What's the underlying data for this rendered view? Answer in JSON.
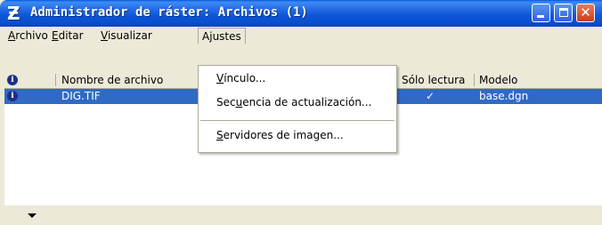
{
  "window": {
    "title": "Administrador de ráster: Archivos (1)",
    "icon": "microstation-app-icon",
    "controls": {
      "minimize": "minimize-icon",
      "maximize": "maximize-icon",
      "close": "close-icon"
    }
  },
  "menubar": {
    "items": [
      {
        "pre": "",
        "key": "A",
        "post": "rchivo"
      },
      {
        "pre": "",
        "key": "E",
        "post": "ditar"
      },
      {
        "pre": "",
        "key": "V",
        "post": "isualizar"
      },
      {
        "pre": "A",
        "key": "j",
        "post": "ustes"
      }
    ]
  },
  "dropdown": {
    "items": [
      {
        "pre": "",
        "key": "V",
        "post": "ínculo..."
      },
      {
        "pre": "Sec",
        "key": "u",
        "post": "encia de actualización..."
      },
      {
        "pre": "",
        "key": "S",
        "post": "ervidores de imagen..."
      }
    ]
  },
  "table": {
    "columns": [
      "Nombre de archivo",
      "Sólo lectura",
      "Modelo"
    ],
    "rows": [
      {
        "icon": "info-icon",
        "name": "DIG.TIF",
        "readonly": "✓",
        "model": "base.dgn",
        "selected": true
      }
    ]
  },
  "status": {
    "expander": "chevron-down-icon"
  },
  "colors": {
    "titlebar": "#0a4fd0",
    "selection": "#316ac5",
    "chrome": "#ece9d8"
  }
}
